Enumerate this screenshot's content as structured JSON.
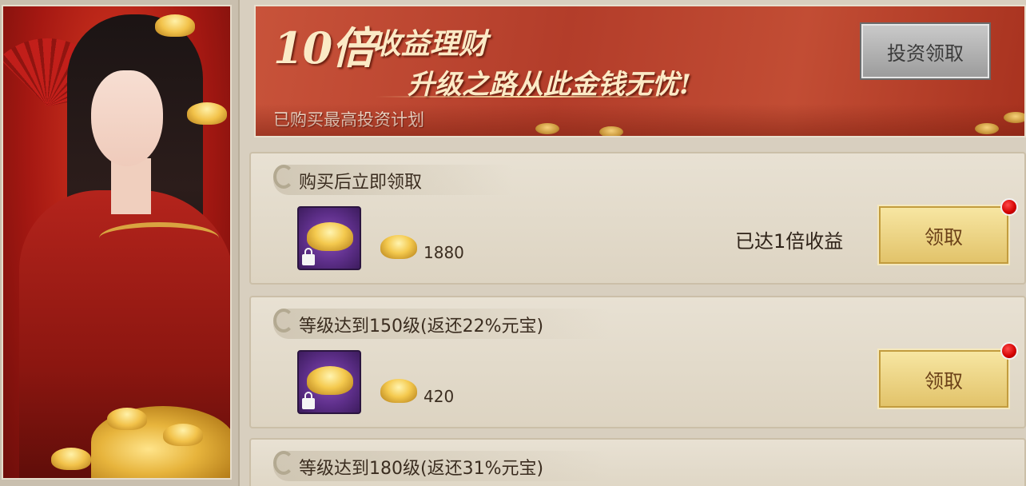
{
  "banner": {
    "multiplier": "10倍",
    "title": "收益理财",
    "subtitle": "升级之路从此金钱无忧!",
    "status": "已购买最高投资计划",
    "invest_button": "投资领取"
  },
  "rewards": [
    {
      "title": "购买后立即领取",
      "amount": "1880",
      "earned": "已达1倍收益",
      "claim_button": "领取",
      "has_notification": true
    },
    {
      "title": "等级达到150级(返还22%元宝)",
      "amount": "420",
      "earned": "",
      "claim_button": "领取",
      "has_notification": true
    },
    {
      "title": "等级达到180级(返还31%元宝)"
    }
  ],
  "icons": {
    "currency": "gold-ingot-icon",
    "lock": "lock-icon",
    "notification": "red-dot-icon"
  },
  "colors": {
    "banner_red": "#b33d2a",
    "claim_gold": "#e2c36a",
    "card_bg": "#e8e1d3",
    "invest_gray": "#9c9c9c"
  }
}
